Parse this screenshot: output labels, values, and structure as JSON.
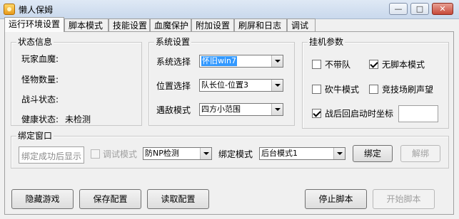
{
  "window": {
    "title": "懒人保姆",
    "controls": {
      "minimize": "—",
      "maximize": "□",
      "close": "✕"
    }
  },
  "tabs": [
    {
      "label": "运行环境设置",
      "active": true
    },
    {
      "label": "脚本模式",
      "active": false
    },
    {
      "label": "技能设置",
      "active": false
    },
    {
      "label": "血魔保护",
      "active": false
    },
    {
      "label": "附加设置",
      "active": false
    },
    {
      "label": "刷屏和日志",
      "active": false
    },
    {
      "label": "调试",
      "active": false
    }
  ],
  "status_group": {
    "title": "状态信息",
    "player_hp_label": "玩家血魔:",
    "monster_count_label": "怪物数量:",
    "battle_state_label": "战斗状态:",
    "health_state_label": "健康状态:",
    "health_state_value": "未检测"
  },
  "system_group": {
    "title": "系统设置",
    "system_label": "系统选择",
    "system_value": "怀旧win7",
    "position_label": "位置选择",
    "position_value": "队长位-位置3",
    "encounter_label": "遇敌模式",
    "encounter_value": "四方小范围"
  },
  "afk_group": {
    "title": "挂机参数",
    "no_team": {
      "label": "不带队",
      "checked": false
    },
    "no_script": {
      "label": "无脚本模式",
      "checked": true
    },
    "chop_wood": {
      "label": "砍牛模式",
      "checked": false
    },
    "arena_fame": {
      "label": "竞技场刷声望",
      "checked": false
    },
    "restart_coords": {
      "label": "战后回启动时坐标",
      "checked": true
    },
    "restart_coords_value": ""
  },
  "bind_group": {
    "title": "绑定窗口",
    "result_text": "绑定成功后显示",
    "debug_mode": {
      "label": "调试模式",
      "checked": false,
      "enabled": false
    },
    "anti_detect_value": "防NP检测",
    "bind_mode_label": "绑定模式",
    "bind_mode_value": "后台模式1",
    "bind_button": "绑定",
    "unbind_button": "解绑"
  },
  "footer": {
    "hide_game": "隐藏游戏",
    "save_config": "保存配置",
    "load_config": "读取配置",
    "stop_script": "停止脚本",
    "start_script": "开始脚本"
  }
}
